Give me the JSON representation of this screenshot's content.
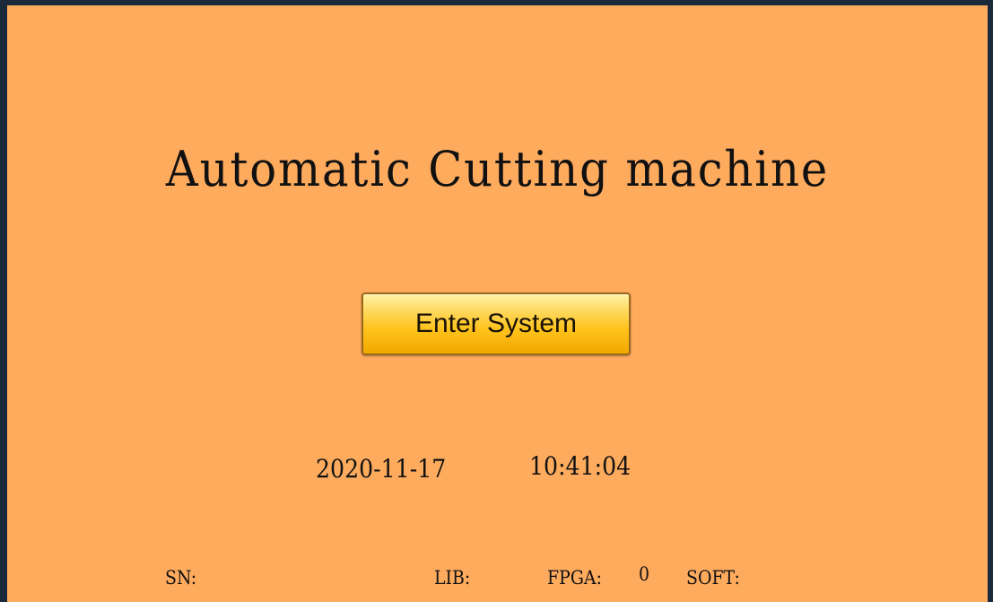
{
  "main": {
    "title": "Automatic Cutting machine",
    "enter_button_label": "Enter System",
    "date": "2020-11-17",
    "time": "10:41:04"
  },
  "footer": {
    "sn_label": "SN:",
    "lib_label": "LIB:",
    "fpga_label": "FPGA:",
    "fpga_value": "0",
    "soft_label": "SOFT:"
  },
  "colors": {
    "background": "#FFAB5E",
    "frame": "#1B2A3A",
    "button": "#FFC21A"
  }
}
